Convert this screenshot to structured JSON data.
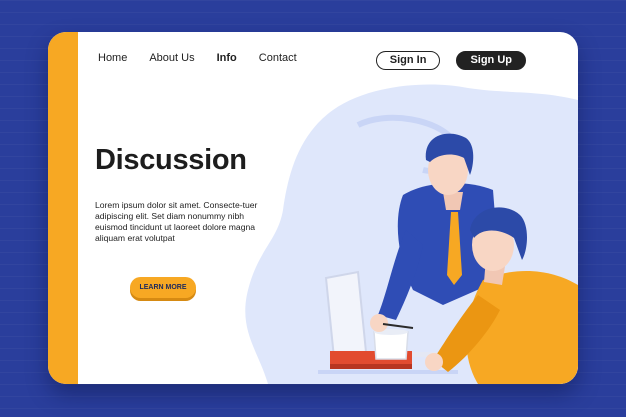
{
  "nav": {
    "items": [
      {
        "label": "Home"
      },
      {
        "label": "About Us"
      },
      {
        "label": "Info"
      },
      {
        "label": "Contact"
      }
    ],
    "active": "Info"
  },
  "auth": {
    "sign_in_label": "Sign In",
    "sign_up_label": "Sign Up"
  },
  "hero": {
    "title": "Discussion",
    "body": "Lorem ipsum dolor sit amet. Consecte-tuer adipiscing elit. Set diam nonummy nibh euismod tincidunt ut laoreet dolore magna aliquam erat volutpat",
    "cta_label": "LEARN MORE"
  },
  "colors": {
    "background": "#2a3e9c",
    "accent": "#f7a823",
    "card": "#ffffff",
    "dark": "#222222",
    "blob": "#dfe7fb"
  },
  "illustration": {
    "icon": "two-people-discussing-at-laptop-illustration"
  }
}
